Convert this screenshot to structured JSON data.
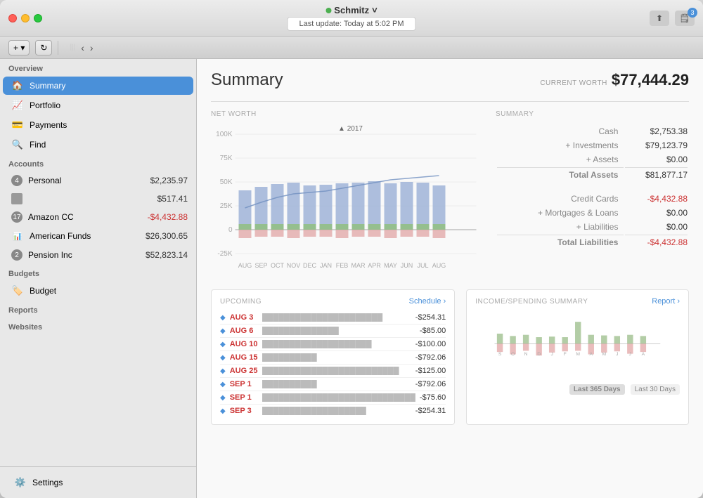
{
  "titlebar": {
    "user": "Schmitz",
    "last_update": "Last update:  Today at 5:02 PM",
    "add_label": "+",
    "refresh_label": "↻",
    "badge_count": "3"
  },
  "toolbar": {
    "add_label": "+  ▾",
    "nav_back": "‹",
    "nav_forward": "›"
  },
  "sidebar": {
    "overview_label": "Overview",
    "items_overview": [
      {
        "id": "summary",
        "label": "Summary",
        "icon": "🏠",
        "active": true
      },
      {
        "id": "portfolio",
        "label": "Portfolio",
        "icon": "📈"
      },
      {
        "id": "payments",
        "label": "Payments",
        "icon": "💳"
      },
      {
        "id": "find",
        "label": "Find",
        "icon": "🔍"
      }
    ],
    "accounts_label": "Accounts",
    "accounts": [
      {
        "id": "personal",
        "label": "Personal",
        "badge": "4",
        "value": "$2,235.97",
        "negative": false
      },
      {
        "id": "account2",
        "label": "",
        "badge": "",
        "value": "$517.41",
        "negative": false
      },
      {
        "id": "amazon-cc",
        "label": "Amazon CC",
        "badge": "17",
        "value": "-$4,432.88",
        "negative": true
      },
      {
        "id": "american-funds",
        "label": "American Funds",
        "badge": "",
        "value": "$26,300.65",
        "negative": false
      },
      {
        "id": "pension-inc",
        "label": "Pension Inc",
        "badge": "2",
        "value": "$52,823.14",
        "negative": false
      }
    ],
    "budgets_label": "Budgets",
    "budgets": [
      {
        "id": "budget",
        "label": "Budget",
        "icon": "🏷️"
      }
    ],
    "reports_label": "Reports",
    "websites_label": "Websites",
    "settings_label": "Settings"
  },
  "main": {
    "title": "Summary",
    "current_worth_label": "CURRENT WORTH",
    "current_worth_value": "$77,444.29",
    "net_worth_label": "NET WORTH",
    "summary_label": "SUMMARY",
    "summary_items": [
      {
        "label": "Cash",
        "value": "$2,753.38"
      },
      {
        "label": "+ Investments",
        "value": "$79,123.79"
      },
      {
        "label": "+ Assets",
        "value": "$0.00"
      },
      {
        "label": "Total Assets",
        "value": "$81,877.17",
        "total": true
      },
      {
        "label": "Credit Cards",
        "value": "-$4,432.88",
        "negative": true
      },
      {
        "label": "+ Mortgages & Loans",
        "value": "$0.00"
      },
      {
        "label": "+ Liabilities",
        "value": "$0.00"
      },
      {
        "label": "Total Liabilities",
        "value": "-$4,432.88",
        "negative": true,
        "total": true
      }
    ],
    "chart_year": "2017",
    "chart_months": [
      "AUG",
      "SEP",
      "OCT",
      "NOV",
      "DEC",
      "JAN",
      "FEB",
      "MAR",
      "APR",
      "MAY",
      "JUN",
      "JUL",
      "AUG"
    ],
    "chart_y_labels": [
      "100K",
      "75K",
      "50K",
      "25K",
      "0",
      "-25K"
    ],
    "upcoming_label": "UPCOMING",
    "schedule_label": "Schedule ›",
    "upcoming_rows": [
      {
        "date": "AUG 3",
        "amount": "-$254.31"
      },
      {
        "date": "AUG 6",
        "amount": "-$85.00"
      },
      {
        "date": "AUG 10",
        "amount": "-$100.00"
      },
      {
        "date": "AUG 15",
        "amount": "-$792.06"
      },
      {
        "date": "AUG 25",
        "amount": "-$125.00"
      },
      {
        "date": "SEP 1",
        "amount": "-$792.06"
      },
      {
        "date": "SEP 1",
        "amount": "-$75.60"
      },
      {
        "date": "SEP 3",
        "amount": "-$254.31"
      }
    ],
    "income_label": "INCOME/SPENDING SUMMARY",
    "report_label": "Report ›",
    "income_months": [
      "S",
      "O",
      "N",
      "D",
      "J",
      "F",
      "M",
      "A",
      "M",
      "J",
      "J",
      "A"
    ],
    "last_365_label": "Last 365 Days",
    "last_30_label": "Last 30 Days",
    "income_bars": [
      {
        "income": 30,
        "spending": 25
      },
      {
        "income": 20,
        "spending": 30
      },
      {
        "income": 25,
        "spending": 20
      },
      {
        "income": 15,
        "spending": 35
      },
      {
        "income": 20,
        "spending": 25
      },
      {
        "income": 18,
        "spending": 22
      },
      {
        "income": 65,
        "spending": 20
      },
      {
        "income": 22,
        "spending": 30
      },
      {
        "income": 20,
        "spending": 25
      },
      {
        "income": 18,
        "spending": 22
      },
      {
        "income": 22,
        "spending": 28
      },
      {
        "income": 20,
        "spending": 25
      }
    ]
  }
}
